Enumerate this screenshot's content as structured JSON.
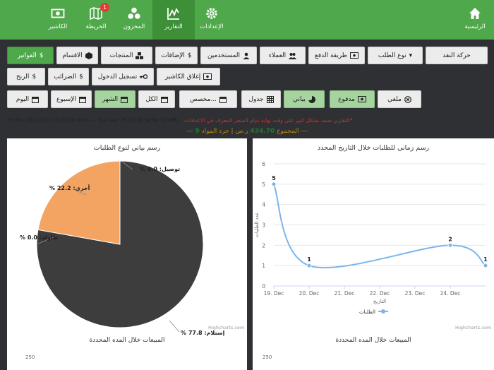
{
  "nav": [
    {
      "label": "الرئيسية",
      "icon": "home-icon"
    },
    {
      "label": "الكاشير",
      "icon": "cash-icon"
    },
    {
      "label": "الخريطة",
      "icon": "map-icon",
      "badge": "1"
    },
    {
      "label": "المخزون",
      "icon": "inventory-icon"
    },
    {
      "label": "التقارير",
      "icon": "chart-icon",
      "active": true
    },
    {
      "label": "الإعدادات",
      "icon": "gear-icon"
    }
  ],
  "tabs_row1": [
    "حركة النقد",
    "نوع الطلب",
    "طريقة الدفع",
    "العملاء",
    "المستخدمين",
    "الإضافات",
    "المنتجات",
    "الاقسام",
    "الفواتير"
  ],
  "tabs_row2": [
    "إغلاق الكاشير",
    "تسجيل الدخول",
    "الضرائب",
    "الربح"
  ],
  "filters": {
    "cancelled": "ملغي",
    "paid": "مدفوع",
    "chart_view": "بياني",
    "table_view": "جدول",
    "custom": "مخصص...",
    "all": "الكل",
    "month": "الشهر",
    "week": "الإسبوع",
    "today": "اليوم"
  },
  "range": {
    "text": "Fri Nov 30 2018 (11:00:00 PM)  ->  Tue Dec 25 2018 (9:59:32 AM)",
    "note": "التقارير تعتمد بشكل كبير على وقت نهاية دوام المتجر المعرف في الاعدادات*"
  },
  "totals": {
    "prefix": "--- المجموع",
    "amount": "434.70",
    "middle": "ر.س | جرد المواد",
    "count": "9",
    "suffix": "---"
  },
  "pie_panel": {
    "title": "رسم بياني لنوع الطلبات",
    "credit": "Highcharts.com",
    "bottom_title": "المبيعات خلال المده المحددة",
    "bottom_value": "250"
  },
  "line_panel": {
    "title": "رسم زماني للطلبات خلال التاريخ المحدد",
    "credit": "Highcharts.com",
    "bottom_title": "المبيعات خلال المده المحددة",
    "bottom_value": "250"
  },
  "chart_data": [
    {
      "type": "pie",
      "title": "رسم بياني لنوع الطلبات",
      "slices": [
        {
          "label": "% إستلام: 77.8",
          "value": 77.8,
          "color": "#3d3d3d"
        },
        {
          "label": "% أخرى: 22.2",
          "value": 22.2,
          "color": "#f4a462"
        },
        {
          "label": "% توصيل: 0.0",
          "value": 0.0,
          "color": "#7cb5ec"
        },
        {
          "label": "% طاولة: 0.0",
          "value": 0.0,
          "color": "#90ed7d"
        }
      ]
    },
    {
      "type": "line",
      "title": "رسم زماني للطلبات خلال التاريخ المحدد",
      "xlabel": "التاريخ",
      "ylabel": "عدد الطلبات",
      "categories": [
        "19. Dec",
        "20. Dec",
        "21. Dec",
        "22. Dec",
        "23. Dec",
        "24. Dec"
      ],
      "x": [
        19,
        20,
        24,
        25
      ],
      "series": [
        {
          "name": "الطلبات",
          "values": [
            5,
            1,
            2,
            1
          ],
          "color": "#7cb5ec"
        }
      ],
      "ylim": [
        0,
        6
      ],
      "yticks": [
        0,
        1,
        2,
        3,
        4,
        5,
        6
      ],
      "grid": true,
      "legend": "bottom"
    }
  ]
}
